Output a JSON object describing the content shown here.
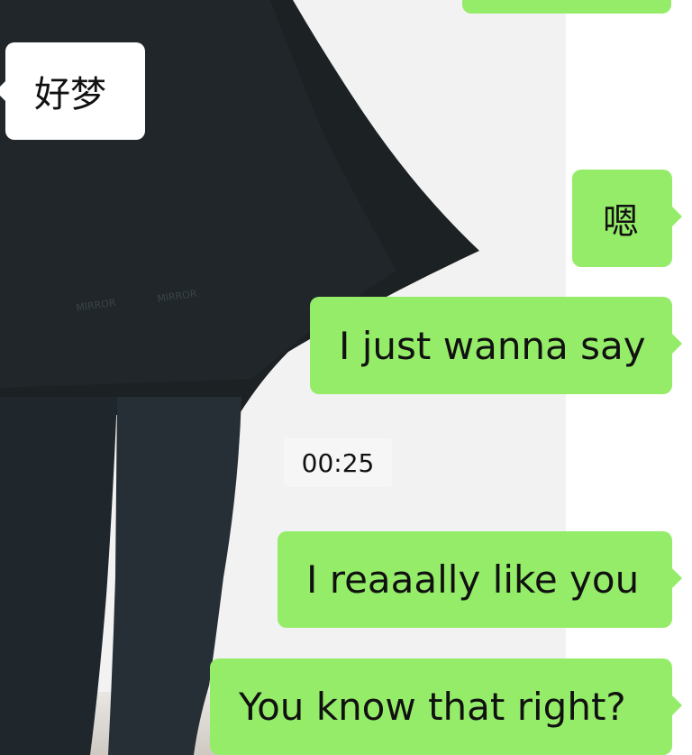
{
  "chat": {
    "messages": [
      {
        "side": "right",
        "text": ""
      },
      {
        "side": "left",
        "text": "好梦"
      },
      {
        "side": "right",
        "text": "嗯"
      },
      {
        "side": "right",
        "text": "I just wanna say"
      },
      {
        "side": "right",
        "text": "I reaaally like you"
      },
      {
        "side": "right",
        "text": "You know that right?"
      }
    ],
    "timestamp": "00:25"
  },
  "colors": {
    "sent_bubble": "#95ec69",
    "received_bubble": "#ffffff",
    "text": "#111111",
    "timestamp_bg": "#f6f6f6"
  }
}
